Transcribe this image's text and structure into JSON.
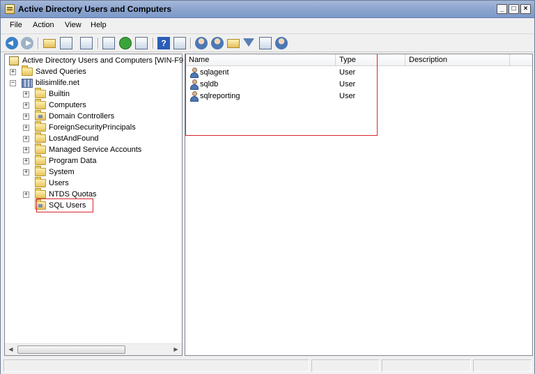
{
  "window": {
    "title": "Active Directory Users and Computers"
  },
  "menu": [
    "File",
    "Action",
    "View",
    "Help"
  ],
  "toolbar_icons": [
    "back-arrow-icon",
    "forward-arrow-icon",
    "up-folder-icon",
    "show-hide-tree-icon",
    "properties-icon",
    "export-icon",
    "refresh-icon",
    "export-list-icon",
    "help-icon",
    "console-icon",
    "new-user-icon",
    "new-group-icon",
    "new-ou-icon",
    "filter-icon",
    "find-icon",
    "add-to-group-icon"
  ],
  "tree": {
    "root_label": "Active Directory Users and Computers [WIN-F9",
    "saved_queries": "Saved Queries",
    "domain": "bilisimlife.net",
    "children": [
      {
        "label": "Builtin",
        "expandable": true,
        "icon": "folder-icon"
      },
      {
        "label": "Computers",
        "expandable": true,
        "icon": "folder-icon"
      },
      {
        "label": "Domain Controllers",
        "expandable": true,
        "icon": "ou-icon"
      },
      {
        "label": "ForeignSecurityPrincipals",
        "expandable": true,
        "icon": "folder-icon"
      },
      {
        "label": "LostAndFound",
        "expandable": true,
        "icon": "folder-icon"
      },
      {
        "label": "Managed Service Accounts",
        "expandable": true,
        "icon": "folder-icon"
      },
      {
        "label": "Program Data",
        "expandable": true,
        "icon": "folder-icon"
      },
      {
        "label": "System",
        "expandable": true,
        "icon": "folder-icon"
      },
      {
        "label": "Users",
        "expandable": false,
        "icon": "folder-icon"
      },
      {
        "label": "NTDS Quotas",
        "expandable": true,
        "icon": "folder-icon"
      },
      {
        "label": "SQL Users",
        "expandable": false,
        "icon": "ou-icon",
        "selected": true
      }
    ]
  },
  "list": {
    "columns": [
      "Name",
      "Type",
      "Description"
    ],
    "rows": [
      {
        "name": "sqlagent",
        "type": "User",
        "description": ""
      },
      {
        "name": "sqldb",
        "type": "User",
        "description": ""
      },
      {
        "name": "sqlreporting",
        "type": "User",
        "description": ""
      }
    ]
  },
  "colors": {
    "highlight_box": "#d7262e",
    "title_bar": "#8ea7d0"
  }
}
